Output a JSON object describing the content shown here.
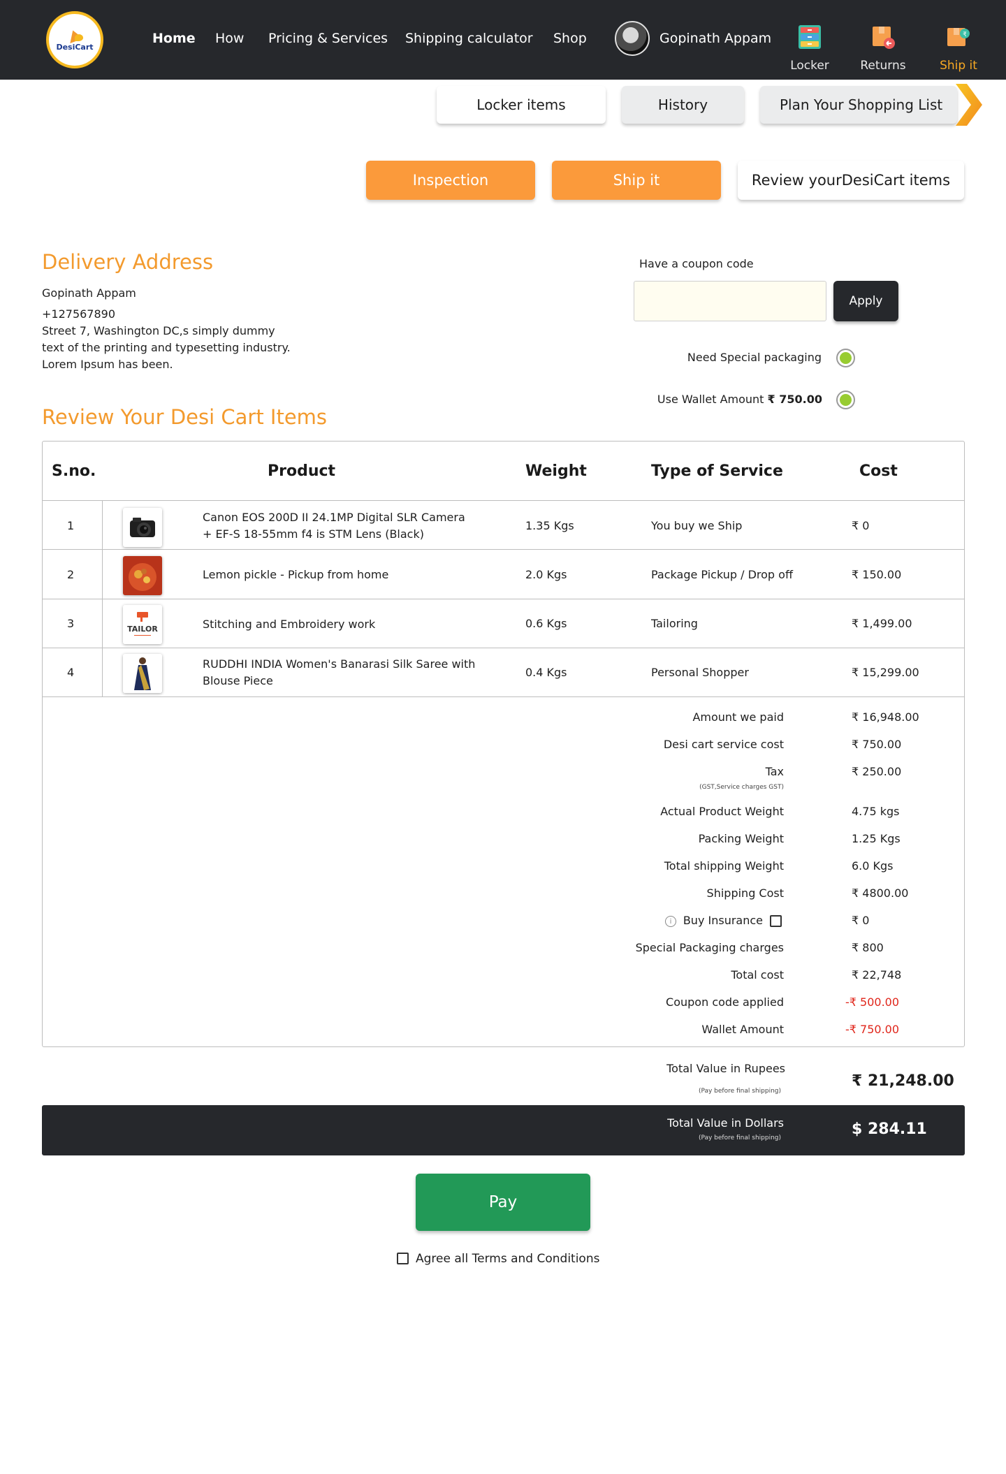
{
  "header": {
    "logo_text": "DesiCart",
    "nav": [
      "Home",
      "How",
      "Pricing & Services",
      "Shipping calculator",
      "Shop"
    ],
    "user_name": "Gopinath Appam",
    "icons": [
      {
        "label": "Locker",
        "icon": "locker-icon"
      },
      {
        "label": "Returns",
        "icon": "returns-icon"
      },
      {
        "label": "Ship it",
        "icon": "ship-it-icon",
        "active": true
      }
    ],
    "accent_color": "#f7a823"
  },
  "tabs": {
    "locker_items": "Locker items",
    "history": "History",
    "plan": "Plan Your Shopping List"
  },
  "steps": {
    "inspection": "Inspection",
    "ship_it": "Ship it",
    "review": "Review yourDesiCart items"
  },
  "address": {
    "title": "Delivery Address",
    "name": "Gopinath Appam",
    "phone": "+127567890",
    "lines": [
      "Street 7, Washington DC,s simply dummy",
      "text of the printing and typesetting industry.",
      "Lorem Ipsum has been."
    ]
  },
  "coupon": {
    "label": "Have a coupon code",
    "value": "",
    "apply": "Apply"
  },
  "options": {
    "special_packaging": "Need Special packaging",
    "wallet_prefix": "Use Wallet Amount",
    "wallet_amount": "₹ 750.00"
  },
  "review": {
    "title": "Review Your Desi Cart Items",
    "columns": [
      "S.no.",
      "Product",
      "Weight",
      "Type of Service",
      "Cost"
    ],
    "rows": [
      {
        "sno": "1",
        "product_line1": "Canon EOS 200D II 24.1MP Digital SLR Camera",
        "product_line2": "+ EF-S 18-55mm f4 is STM Lens (Black)",
        "weight": "1.35 Kgs",
        "service": "You buy we Ship",
        "cost": "₹ 0",
        "image": "camera"
      },
      {
        "sno": "2",
        "product_line1": "Lemon pickle - Pickup from home",
        "product_line2": "",
        "weight": "2.0 Kgs",
        "service": "Package Pickup / Drop off",
        "cost": "₹ 150.00",
        "image": "pickle"
      },
      {
        "sno": "3",
        "product_line1": "Stitching and Embroidery work",
        "product_line2": "",
        "weight": "0.6 Kgs",
        "service": "Tailoring",
        "cost": "₹ 1,499.00",
        "image": "tailor"
      },
      {
        "sno": "4",
        "product_line1": "RUDDHI INDIA Women's Banarasi Silk Saree with",
        "product_line2": "Blouse Piece",
        "weight": "0.4 Kgs",
        "service": "Personal Shopper",
        "cost": "₹ 15,299.00",
        "image": "saree"
      }
    ],
    "tailor_text": "TAILOR"
  },
  "summary": {
    "amount_paid": {
      "label": "Amount we paid",
      "value": "₹ 16,948.00"
    },
    "service_cost": {
      "label": "Desi cart service cost",
      "value": "₹ 750.00"
    },
    "tax": {
      "label": "Tax",
      "note": "(GST,Service charges GST)",
      "value": "₹ 250.00"
    },
    "actual_weight": {
      "label": "Actual Product Weight",
      "value": "4.75 kgs"
    },
    "packing_weight": {
      "label": "Packing Weight",
      "value": "1.25 Kgs"
    },
    "total_weight": {
      "label": "Total shipping Weight",
      "value": "6.0 Kgs"
    },
    "shipping_cost": {
      "label": "Shipping Cost",
      "value": "₹ 4800.00"
    },
    "insurance": {
      "label": "Buy Insurance",
      "value": "₹ 0"
    },
    "special_packaging": {
      "label": "Special Packaging charges",
      "value": "₹ 800"
    },
    "total_cost": {
      "label": "Total cost",
      "value": "₹ 22,748"
    },
    "coupon": {
      "label": "Coupon code applied",
      "value": "-₹ 500.00"
    },
    "wallet": {
      "label": "Wallet Amount",
      "value": "-₹ 750.00"
    }
  },
  "totals": {
    "rupees_label": "Total Value in Rupees",
    "rupees_note": "(Pay before final shipping)",
    "rupees_value": "₹ 21,248.00",
    "dollars_label": "Total Value in Dollars",
    "dollars_note": "(Pay before final shipping)",
    "dollars_value": "$ 284.11"
  },
  "pay": {
    "label": "Pay",
    "terms": "Agree all Terms and Conditions"
  }
}
